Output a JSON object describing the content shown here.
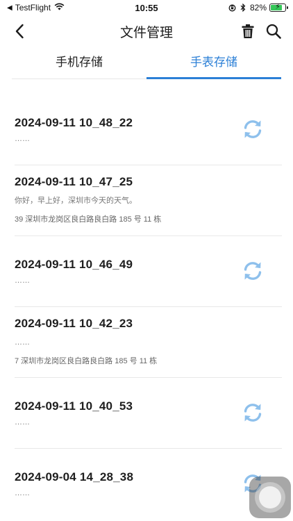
{
  "status_bar": {
    "carrier": "TestFlight",
    "time": "10:55",
    "battery": "82%",
    "battery_level": 0.82,
    "battery_color": "#35c759"
  },
  "nav": {
    "title": "文件管理",
    "back_icon": "chevron-left-icon",
    "delete_icon": "trash-icon",
    "search_icon": "search-icon"
  },
  "tabs": [
    {
      "label": "手机存储",
      "active": false
    },
    {
      "label": "手表存储",
      "active": true
    }
  ],
  "accent_color": "#2b7fd6",
  "sync_icon_color": "#8ec0ec",
  "files": [
    {
      "title": "2024-09-11 10_48_22",
      "sub1": "……",
      "sub2": "",
      "has_sync": true
    },
    {
      "title": "2024-09-11 10_47_25",
      "sub1": "你好，早上好，深圳市今天的天气。",
      "sub2": "39 深圳市龙岗区良白路良白路 185 号 11 栋",
      "has_sync": false
    },
    {
      "title": "2024-09-11 10_46_49",
      "sub1": "……",
      "sub2": "",
      "has_sync": true
    },
    {
      "title": "2024-09-11 10_42_23",
      "sub1": "……",
      "sub2": "7 深圳市龙岗区良白路良白路 185 号 11 栋",
      "has_sync": false
    },
    {
      "title": "2024-09-11 10_40_53",
      "sub1": "……",
      "sub2": "",
      "has_sync": true
    },
    {
      "title": "2024-09-04 14_28_38",
      "sub1": "……",
      "sub2": "",
      "has_sync": true
    }
  ]
}
